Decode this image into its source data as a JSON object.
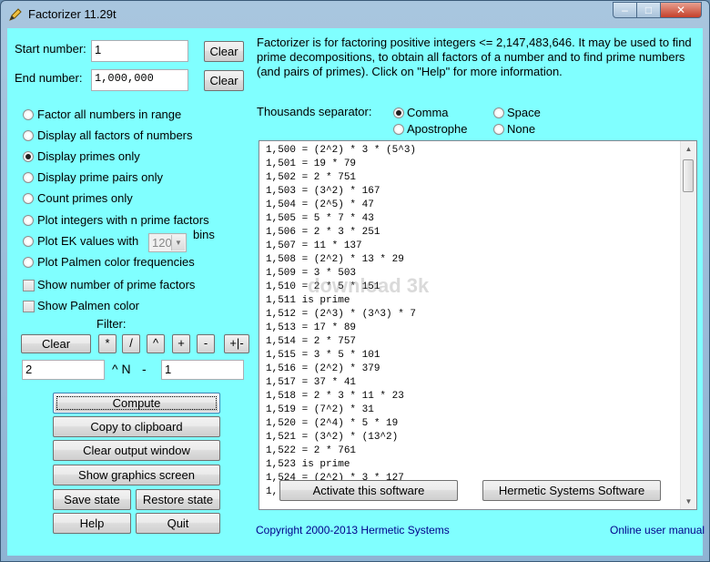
{
  "window": {
    "title": "Factorizer 11.29t",
    "minimize": "–",
    "maximize": "□",
    "close": "✕"
  },
  "inputs": {
    "start_label": "Start number:",
    "start_value": "1",
    "end_label": "End number:",
    "end_value": "1,000,000",
    "clear_label": "Clear"
  },
  "description": "Factorizer is for factoring positive integers <= 2,147,483,646.  It may be used to find prime decompositions, to obtain all factors of a number and to find prime numbers (and pairs of primes).  Click on \"Help\" for more information.",
  "modes": [
    {
      "label": "Factor all numbers in range",
      "selected": false
    },
    {
      "label": "Display all factors of numbers",
      "selected": false
    },
    {
      "label": "Display primes only",
      "selected": true
    },
    {
      "label": "Display prime pairs only",
      "selected": false
    },
    {
      "label": "Count primes only",
      "selected": false
    },
    {
      "label": "Plot integers with n  prime factors",
      "selected": false
    },
    {
      "label": "Plot EK values with",
      "selected": false
    },
    {
      "label": "Plot Palmen color frequencies",
      "selected": false
    }
  ],
  "bins": {
    "value": "120",
    "label": "bins"
  },
  "checkboxes": [
    {
      "label": "Show number of prime factors",
      "checked": false
    },
    {
      "label": "Show Palmen color",
      "checked": false
    }
  ],
  "filter": {
    "label": "Filter:",
    "clear": "Clear",
    "ops": [
      "*",
      "/",
      "^",
      "+",
      "-",
      "+|-"
    ],
    "left_value": "2",
    "caret_n": "^ N",
    "minus": "-",
    "right_value": "1"
  },
  "actions": {
    "compute": "Compute",
    "copy": "Copy to clipboard",
    "clear_output": "Clear output window",
    "graphics": "Show graphics screen",
    "save": "Save state",
    "restore": "Restore state",
    "help": "Help",
    "quit": "Quit"
  },
  "separator": {
    "label": "Thousands separator:",
    "options": [
      {
        "label": "Comma",
        "selected": true
      },
      {
        "label": "Space",
        "selected": false
      },
      {
        "label": "Apostrophe",
        "selected": false
      },
      {
        "label": "None",
        "selected": false
      }
    ]
  },
  "output_lines": [
    "1,500 = (2^2) * 3 * (5^3)",
    "1,501 = 19 * 79",
    "1,502 = 2 * 751",
    "1,503 = (3^2) * 167",
    "1,504 = (2^5) * 47",
    "1,505 = 5 * 7 * 43",
    "1,506 = 2 * 3 * 251",
    "1,507 = 11 * 137",
    "1,508 = (2^2) * 13 * 29",
    "1,509 = 3 * 503",
    "1,510 = 2 * 5 * 151",
    "1,511 is prime",
    "1,512 = (2^3) * (3^3) * 7",
    "1,513 = 17 * 89",
    "1,514 = 2 * 757",
    "1,515 = 3 * 5 * 101",
    "1,516 = (2^2) * 379",
    "1,517 = 37 * 41",
    "1,518 = 2 * 3 * 11 * 23",
    "1,519 = (7^2) * 31",
    "1,520 = (2^4) * 5 * 19",
    "1,521 = (3^2) * (13^2)",
    "1,522 = 2 * 761",
    "1,523 is prime",
    "1,524 = (2^2) * 3 * 127",
    "1,"
  ],
  "watermark": "download 3k",
  "bottom_buttons": {
    "activate": "Activate this software",
    "hermetic": "Hermetic Systems Software"
  },
  "footer": {
    "copyright": "Copyright 2000-2013 Hermetic Systems",
    "manual": "Online user manual"
  }
}
